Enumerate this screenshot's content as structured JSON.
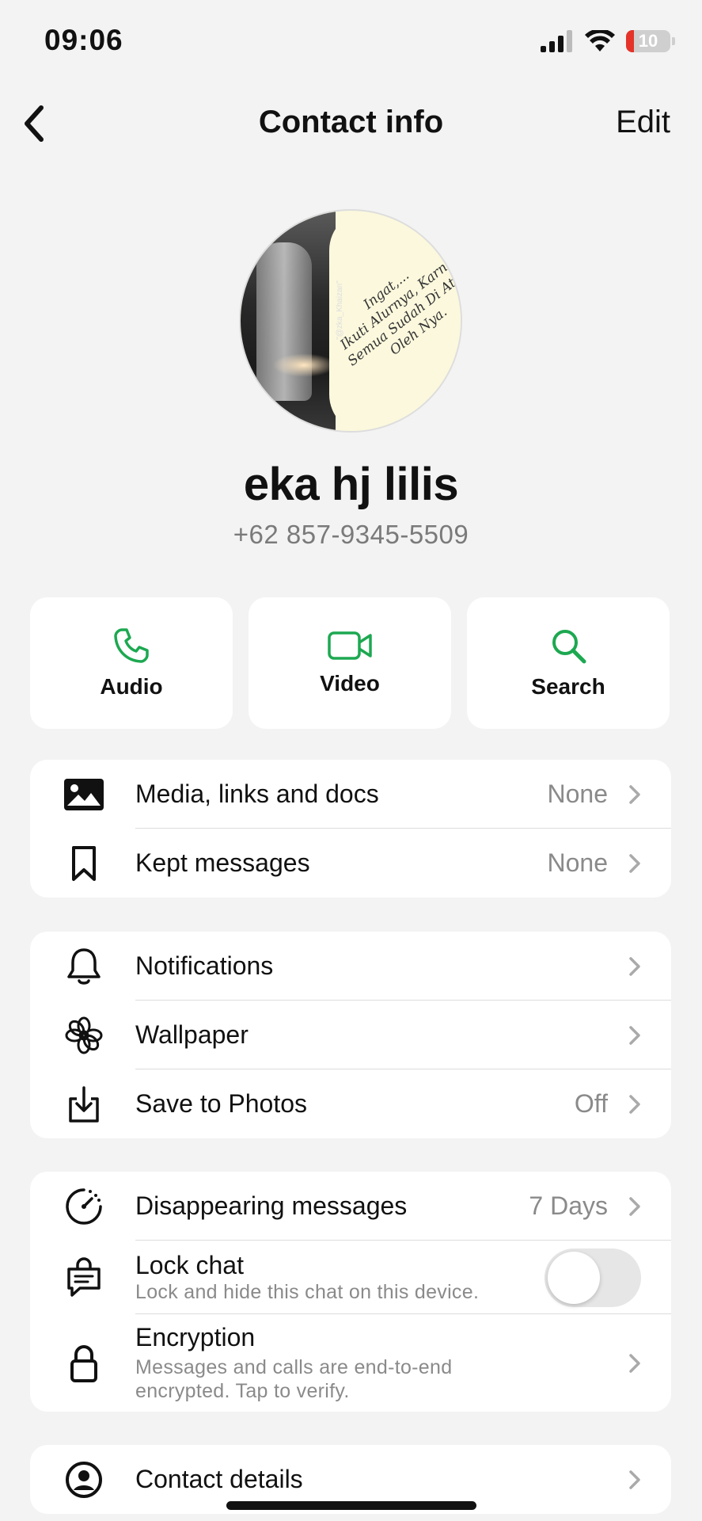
{
  "status_bar": {
    "time": "09:06",
    "battery": "10"
  },
  "nav": {
    "title": "Contact info",
    "edit_label": "Edit"
  },
  "avatar": {
    "text_line1": "Ingat,...",
    "text_line2": "Ikuti Alurnya, Karna",
    "text_line3": "Semua Sudah Di Atur",
    "text_line4": "Oleh Nya.",
    "handle": "\"@zka_Khaizan\""
  },
  "contact": {
    "name": "eka hj lilis",
    "phone": "+62 857-9345-5509"
  },
  "actions": [
    {
      "label": "Audio",
      "icon": "phone-icon"
    },
    {
      "label": "Video",
      "icon": "video-icon"
    },
    {
      "label": "Search",
      "icon": "search-icon"
    }
  ],
  "group1": [
    {
      "title": "Media, links and docs",
      "value": "None"
    },
    {
      "title": "Kept messages",
      "value": "None"
    }
  ],
  "group2": [
    {
      "title": "Notifications",
      "value": ""
    },
    {
      "title": "Wallpaper",
      "value": ""
    },
    {
      "title": "Save to Photos",
      "value": "Off"
    }
  ],
  "group3": {
    "disappearing": {
      "title": "Disappearing messages",
      "value": "7 Days"
    },
    "lock": {
      "title": "Lock chat",
      "sub": "Lock and hide this chat on this device."
    },
    "encryption": {
      "title": "Encryption",
      "sub1": "Messages and calls are end-to-end",
      "sub2": "encrypted. Tap to verify."
    }
  },
  "group4": [
    {
      "title": "Contact details"
    }
  ],
  "colors": {
    "accent": "#1da851",
    "background": "#f3f3f3",
    "secondary_text": "#8a8a8a"
  }
}
